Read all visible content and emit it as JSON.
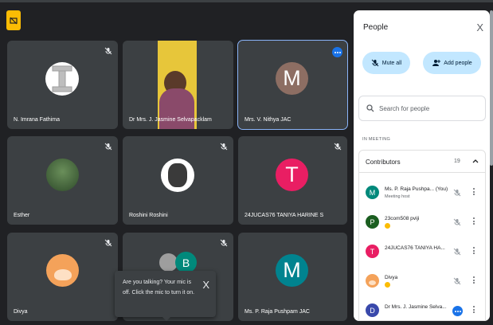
{
  "tiles": [
    {
      "name": "N. Imrana Fathima",
      "avatar_letter": "I"
    },
    {
      "name": "Dr Mrs. J. Jasmine Selvapacklam"
    },
    {
      "name": "Mrs. V. Nithya JAC",
      "avatar_letter": "M"
    },
    {
      "name": "Esther"
    },
    {
      "name": "Roshini Roshini"
    },
    {
      "name": "24JUCAS76 TANIYA HARINE S",
      "avatar_letter": "T"
    },
    {
      "name": "Divya"
    },
    {
      "name": "",
      "avatar_letter": "B"
    },
    {
      "name": "Ms. P. Raja Pushpam JAC",
      "avatar_letter": "M"
    }
  ],
  "toast": {
    "text": "Are you talking? Your mic is off. Click the mic to turn it on.",
    "close": "X"
  },
  "panel": {
    "title": "People",
    "close": "X",
    "mute_all": "Mute all",
    "add_people": "Add people",
    "search_placeholder": "Search for people",
    "section": "IN MEETING",
    "group_label": "Contributors",
    "group_count": "19",
    "rows": [
      {
        "name": "Ms. P. Raja Pushpa... (You)",
        "sub": "Meeting host",
        "letter": "M"
      },
      {
        "name": "23com508 pviji",
        "letter": "P"
      },
      {
        "name": "24JUCAS76 TANIYA HA...",
        "letter": "T"
      },
      {
        "name": "Divya",
        "letter": ""
      },
      {
        "name": "Dr Mrs. J. Jasmine Selva...",
        "letter": "D"
      }
    ]
  },
  "colors": {
    "background": "#202124",
    "tile": "#3c4043",
    "accent": "#8ab4f8",
    "pill": "#c2e7ff",
    "hand": "#fbbc04"
  },
  "icons": [
    "presentation-badge-icon",
    "mic-off-icon",
    "more-vert-icon",
    "search-icon",
    "add-person-icon",
    "close-icon",
    "chevron-up-icon"
  ]
}
